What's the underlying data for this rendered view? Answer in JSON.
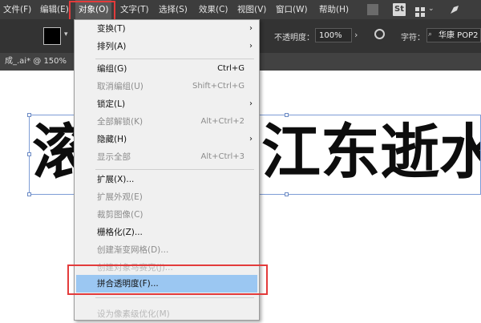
{
  "menubar": {
    "items": [
      "文件(F)",
      "编辑(E)",
      "对象(O)",
      "文字(T)",
      "选择(S)",
      "效果(C)",
      "视图(V)",
      "窗口(W)",
      "帮助(H)"
    ],
    "active": "对象(O)",
    "icons": [
      "ai-icon",
      "stock-icon",
      "grid-icon",
      "chevron-down-icon",
      "pen-icon"
    ],
    "stock_label": "St"
  },
  "control_bar": {
    "fill_color": "#000000",
    "opacity_label": "不透明度：",
    "opacity_value": "100%",
    "character_label": "字符：",
    "font_value": "华康 POP2"
  },
  "document_tab": {
    "label": "成_.ai* @ 150%"
  },
  "canvas": {
    "text_left": "滚",
    "text_right": "江东逝水"
  },
  "menu": {
    "items": [
      {
        "label": "变换(T)",
        "shortcut": "",
        "submenu": true,
        "enabled": true
      },
      {
        "label": "排列(A)",
        "shortcut": "",
        "submenu": true,
        "enabled": true
      },
      {
        "label": "编组(G)",
        "shortcut": "Ctrl+G",
        "submenu": false,
        "enabled": true
      },
      {
        "label": "取消编组(U)",
        "shortcut": "Shift+Ctrl+G",
        "submenu": false,
        "enabled": false
      },
      {
        "label": "锁定(L)",
        "shortcut": "",
        "submenu": true,
        "enabled": true
      },
      {
        "label": "全部解锁(K)",
        "shortcut": "Alt+Ctrl+2",
        "submenu": false,
        "enabled": false
      },
      {
        "label": "隐藏(H)",
        "shortcut": "",
        "submenu": true,
        "enabled": true
      },
      {
        "label": "显示全部",
        "shortcut": "Alt+Ctrl+3",
        "submenu": false,
        "enabled": false
      },
      {
        "label": "扩展(X)...",
        "shortcut": "",
        "submenu": false,
        "enabled": true
      },
      {
        "label": "扩展外观(E)",
        "shortcut": "",
        "submenu": false,
        "enabled": false
      },
      {
        "label": "裁剪图像(C)",
        "shortcut": "",
        "submenu": false,
        "enabled": false
      },
      {
        "label": "栅格化(Z)...",
        "shortcut": "",
        "submenu": false,
        "enabled": true
      },
      {
        "label": "创建渐变网格(D)...",
        "shortcut": "",
        "submenu": false,
        "enabled": false
      },
      {
        "label": "创建对象马赛克(J)...",
        "shortcut": "",
        "submenu": false,
        "enabled": false
      },
      {
        "label": "拼合透明度(F)...",
        "shortcut": "",
        "submenu": false,
        "enabled": true,
        "highlighted": true
      },
      {
        "label": "设为像素级优化(M)",
        "shortcut": "",
        "submenu": false,
        "enabled": false
      }
    ]
  },
  "colors": {
    "menubar_bg": "#3d3d3d",
    "highlight": "#9bc7f2",
    "annotation_red": "#e33b3b"
  }
}
